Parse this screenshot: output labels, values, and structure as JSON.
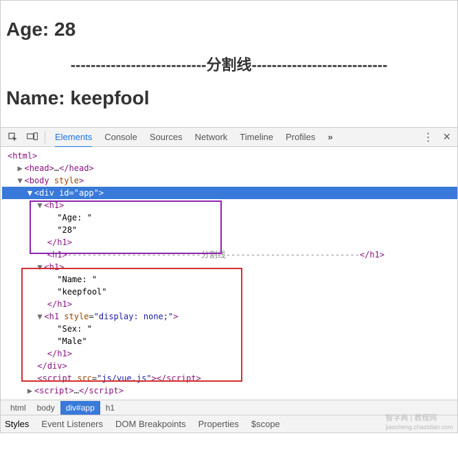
{
  "page": {
    "age_label": "Age: ",
    "age_value": "28",
    "divider": "---------------------------分割线---------------------------",
    "name_label": "Name: ",
    "name_value": "keepfool"
  },
  "devtools": {
    "tabs": [
      "Elements",
      "Console",
      "Sources",
      "Network",
      "Timeline",
      "Profiles"
    ],
    "more": "»",
    "menu_icon": "⋮",
    "close_icon": "×",
    "breadcrumb": [
      "html",
      "body",
      "div#app",
      "h1"
    ],
    "subtabs": [
      "Styles",
      "Event Listeners",
      "DOM Breakpoints",
      "Properties",
      "$scope"
    ],
    "watermark": "智字典 | 教程网",
    "watermark_sub": "jiaocheng.chazidian.com"
  },
  "dom": {
    "html_open": "<html>",
    "head": "<head>…</head>",
    "body_open": "<body style>",
    "app_open": "<div id=\"app\">",
    "h1_open": "<h1>",
    "age_text": "\"Age: \"",
    "age_val": "\"28\"",
    "h1_close": "</h1>",
    "divider_open": "<h1>",
    "divider_text": "---------------------------分割线---------------------------",
    "divider_close": "</h1>",
    "name_text": "\"Name: \"",
    "name_val": "\"keepfool\"",
    "h1_hidden_open": "<h1 style=\"display: none;\">",
    "sex_text": "\"Sex: \"",
    "sex_val": "\"Male\"",
    "div_close": "</div>",
    "script1": "<script src=\"js/vue.js\"></scr",
    "script1b": "ipt>",
    "script2": "<script>…</scr",
    "script2b": "ipt>"
  }
}
